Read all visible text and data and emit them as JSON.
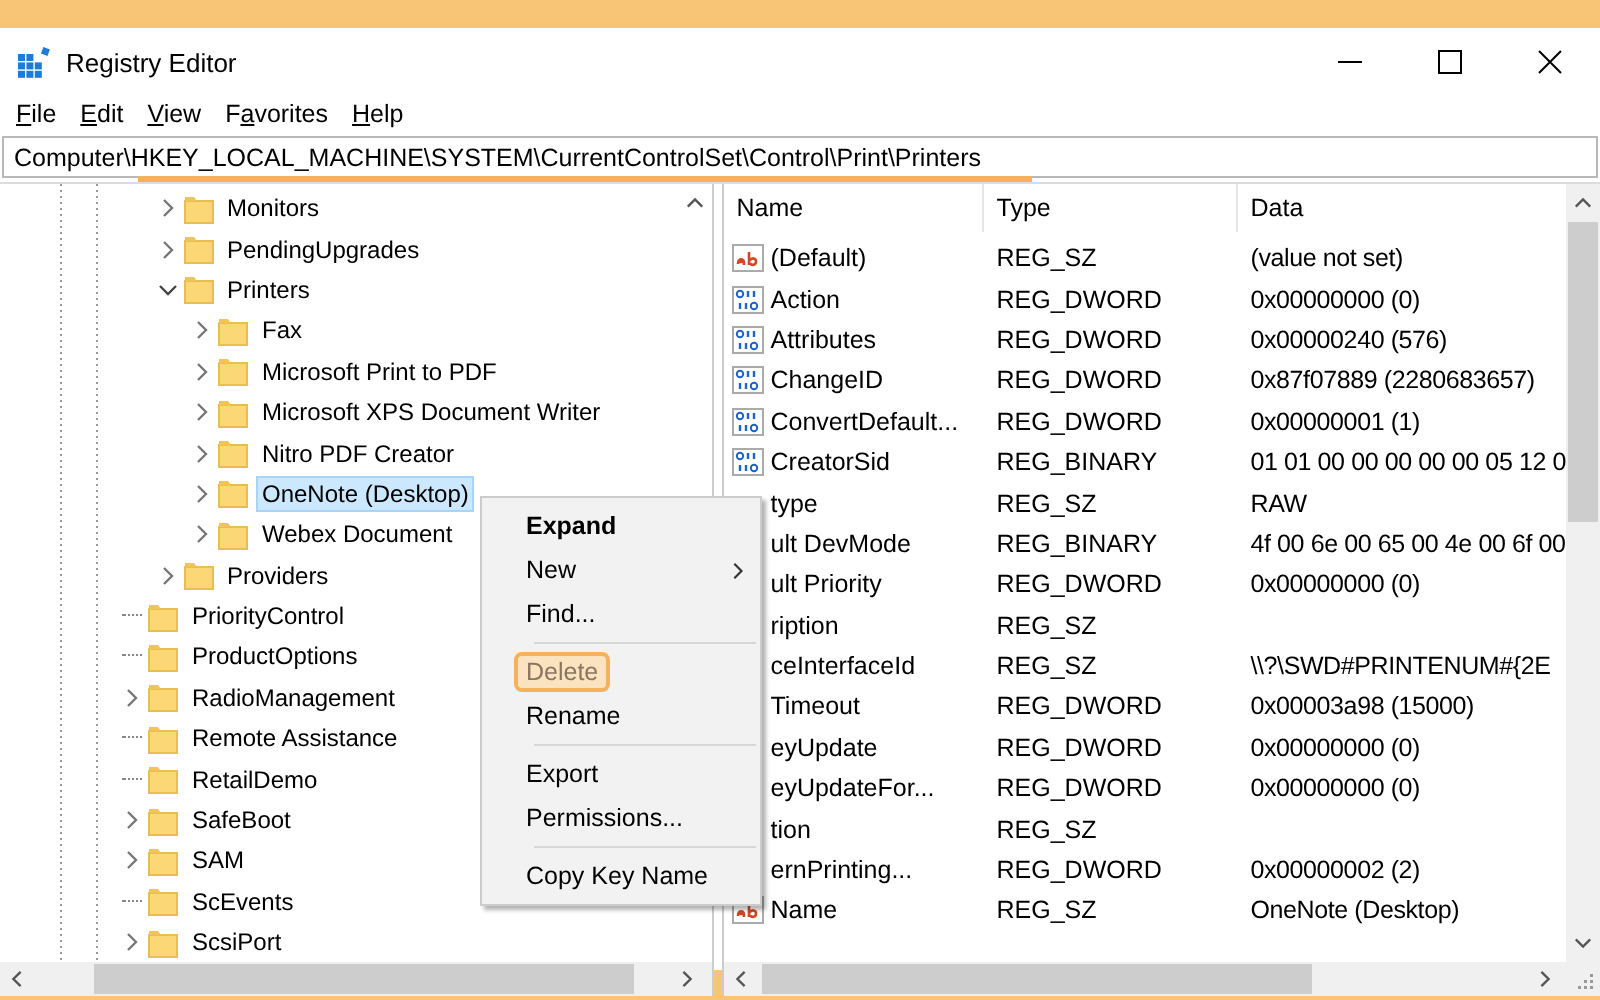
{
  "window": {
    "title": "Registry Editor"
  },
  "menu": [
    {
      "key": "F",
      "post": "ile"
    },
    {
      "key": "E",
      "post": "dit"
    },
    {
      "key": "V",
      "post": "iew"
    },
    {
      "pre": "F",
      "key": "a",
      "post": "vorites"
    },
    {
      "key": "H",
      "post": "elp"
    }
  ],
  "address": {
    "value": "Computer\\HKEY_LOCAL_MACHINE\\SYSTEM\\CurrentControlSet\\Control\\Print\\Printers",
    "highlighted": true
  },
  "tree": {
    "partial_branch": [
      {
        "label": "Monitors",
        "expandable": true,
        "expanded": false,
        "selected": false
      },
      {
        "label": "PendingUpgrades",
        "expandable": true,
        "expanded": false,
        "selected": false
      },
      {
        "label": "Printers",
        "expandable": true,
        "expanded": true,
        "selected": false,
        "children": [
          {
            "label": "Fax",
            "expandable": true,
            "expanded": false,
            "selected": false
          },
          {
            "label": "Microsoft Print to PDF",
            "expandable": true,
            "expanded": false,
            "selected": false
          },
          {
            "label": "Microsoft XPS Document Writer",
            "expandable": true,
            "expanded": false,
            "selected": false
          },
          {
            "label": "Nitro PDF Creator",
            "expandable": true,
            "expanded": false,
            "selected": false
          },
          {
            "label": "OneNote (Desktop)",
            "expandable": true,
            "expanded": false,
            "selected": true
          },
          {
            "label": "Webex Document",
            "expandable": true,
            "expanded": false,
            "selected": false
          }
        ]
      },
      {
        "label": "Providers",
        "expandable": true,
        "expanded": false,
        "selected": false
      }
    ],
    "items": [
      {
        "label": "PriorityControl",
        "expandable": false,
        "selected": false
      },
      {
        "label": "ProductOptions",
        "expandable": false,
        "selected": false
      },
      {
        "label": "RadioManagement",
        "expandable": true,
        "expanded": false,
        "selected": false
      },
      {
        "label": "Remote Assistance",
        "expandable": false,
        "selected": false
      },
      {
        "label": "RetailDemo",
        "expandable": false,
        "selected": false
      },
      {
        "label": "SafeBoot",
        "expandable": true,
        "expanded": false,
        "selected": false
      },
      {
        "label": "SAM",
        "expandable": true,
        "expanded": false,
        "selected": false
      },
      {
        "label": "ScEvents",
        "expandable": false,
        "selected": false
      },
      {
        "label": "ScsiPort",
        "expandable": true,
        "expanded": false,
        "selected": false
      }
    ]
  },
  "table": {
    "columns": [
      "Name",
      "Type",
      "Data"
    ],
    "rows": [
      {
        "kind": "string",
        "name": "(Default)",
        "type": "REG_SZ",
        "data": "(value not set)"
      },
      {
        "kind": "number",
        "name": "Action",
        "type": "REG_DWORD",
        "data": "0x00000000 (0)"
      },
      {
        "kind": "number",
        "name": "Attributes",
        "type": "REG_DWORD",
        "data": "0x00000240 (576)"
      },
      {
        "kind": "number",
        "name": "ChangeID",
        "type": "REG_DWORD",
        "data": "0x87f07889 (2280683657)"
      },
      {
        "kind": "number",
        "name": "ConvertDefault...",
        "type": "REG_DWORD",
        "data": "0x00000001 (1)"
      },
      {
        "kind": "number",
        "name": "CreatorSid",
        "type": "REG_BINARY",
        "data": "01 01 00 00 00 00 00 05 12 0"
      },
      {
        "kind": "covered",
        "name": "type",
        "type": "REG_SZ",
        "data": "RAW"
      },
      {
        "kind": "covered",
        "name": "ult DevMode",
        "type": "REG_BINARY",
        "data": "4f 00 6e 00 65 00 4e 00 6f 00"
      },
      {
        "kind": "covered",
        "name": "ult Priority",
        "type": "REG_DWORD",
        "data": "0x00000000 (0)"
      },
      {
        "kind": "covered",
        "name": "ription",
        "type": "REG_SZ"
      },
      {
        "kind": "covered",
        "name": "ceInterfaceId",
        "type": "REG_SZ",
        "data": "\\\\?\\SWD#PRINTENUM#{2E"
      },
      {
        "kind": "covered",
        "name": "Timeout",
        "type": "REG_DWORD",
        "data": "0x00003a98 (15000)"
      },
      {
        "kind": "covered",
        "name": "eyUpdate",
        "type": "REG_DWORD",
        "data": "0x00000000 (0)"
      },
      {
        "kind": "covered",
        "name": "eyUpdateFor...",
        "type": "REG_DWORD",
        "data": "0x00000000 (0)"
      },
      {
        "kind": "covered",
        "name": "tion",
        "type": "REG_SZ"
      },
      {
        "kind": "covered",
        "name": "ernPrinting...",
        "type": "REG_DWORD",
        "data": "0x00000002 (2)"
      },
      {
        "kind": "string",
        "name": "Name",
        "type": "REG_SZ",
        "data": "OneNote (Desktop)"
      }
    ]
  },
  "context_menu": [
    {
      "kind": "item",
      "label": "Expand",
      "bold": true,
      "submenu": false,
      "highlighted": false
    },
    {
      "kind": "item",
      "label": "New",
      "bold": false,
      "submenu": true,
      "highlighted": false
    },
    {
      "kind": "item",
      "label": "Find...",
      "bold": false,
      "submenu": false,
      "highlighted": false
    },
    {
      "kind": "separator"
    },
    {
      "kind": "item",
      "label": "Delete",
      "bold": false,
      "submenu": false,
      "highlighted": true
    },
    {
      "kind": "item",
      "label": "Rename",
      "bold": false,
      "submenu": false,
      "highlighted": false
    },
    {
      "kind": "separator"
    },
    {
      "kind": "item",
      "label": "Export",
      "bold": false,
      "submenu": false,
      "highlighted": false
    },
    {
      "kind": "item",
      "label": "Permissions...",
      "bold": false,
      "submenu": false,
      "highlighted": false
    },
    {
      "kind": "separator"
    },
    {
      "kind": "item",
      "label": "Copy Key Name",
      "bold": false,
      "submenu": false,
      "highlighted": false
    }
  ]
}
